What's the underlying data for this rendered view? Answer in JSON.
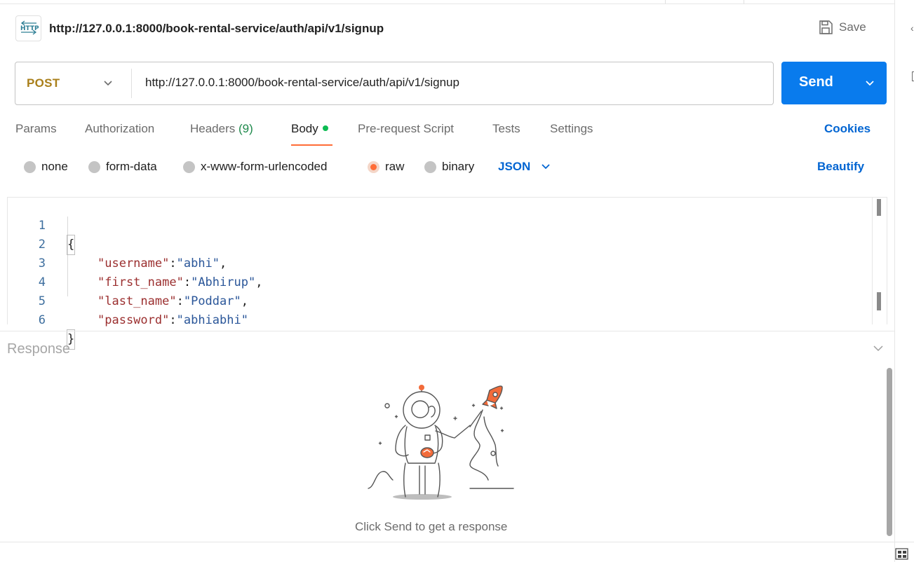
{
  "header": {
    "icon_label": "HTTP",
    "title": "http://127.0.0.1:8000/book-rental-service/auth/api/v1/signup",
    "save_label": "Save"
  },
  "request": {
    "method": "POST",
    "url": "http://127.0.0.1:8000/book-rental-service/auth/api/v1/signup",
    "send_label": "Send"
  },
  "tabs": {
    "params": "Params",
    "authorization": "Authorization",
    "headers": "Headers",
    "headers_count": "(9)",
    "body": "Body",
    "pre_request": "Pre-request Script",
    "tests": "Tests",
    "settings": "Settings",
    "active": "Body",
    "cookies": "Cookies"
  },
  "body_types": {
    "none": "none",
    "form_data": "form-data",
    "urlencoded": "x-www-form-urlencoded",
    "raw": "raw",
    "binary": "binary",
    "selected": "raw",
    "format": "JSON",
    "beautify": "Beautify"
  },
  "editor": {
    "lines": [
      {
        "no": "1",
        "open": "{"
      },
      {
        "no": "2",
        "key": "\"username\"",
        "sep": ":",
        "value": "\"abhi\"",
        "trail": ","
      },
      {
        "no": "3",
        "key": "\"first_name\"",
        "sep": ":",
        "value": "\"Abhirup\"",
        "trail": ","
      },
      {
        "no": "4",
        "key": "\"last_name\"",
        "sep": ":",
        "value": "\"Poddar\"",
        "trail": ","
      },
      {
        "no": "5",
        "key": "\"password\"",
        "sep": ":",
        "value": "\"abhiabhi\"",
        "trail": ""
      },
      {
        "no": "6",
        "close": "}"
      }
    ]
  },
  "response": {
    "title": "Response",
    "hint": "Click Send to get a response"
  },
  "colors": {
    "send": "#097bed",
    "method": "#a97f1a",
    "accent": "#ff6c37",
    "link": "#0265d2",
    "success": "#0cbb52"
  },
  "icons": [
    "http-icon",
    "save-icon",
    "chevron-down-icon",
    "astronaut-rocket-illustration",
    "layout-toggle-icon"
  ]
}
